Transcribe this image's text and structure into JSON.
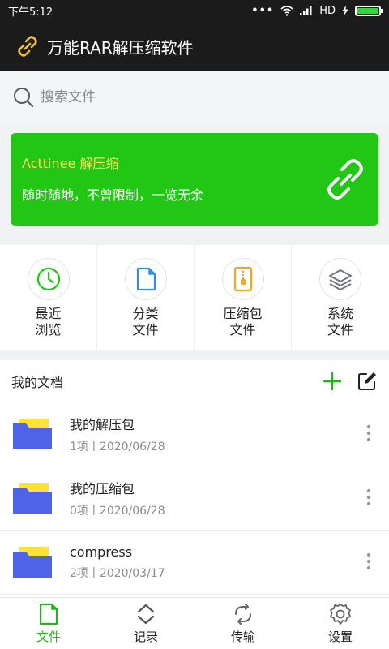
{
  "status": {
    "time": "下午5:12",
    "network": "HD"
  },
  "appbar": {
    "title": "万能RAR解压缩软件"
  },
  "search": {
    "placeholder": "搜索文件"
  },
  "banner": {
    "title": "Acttinee 解压缩",
    "subtitle": "随时随地，不曾限制，一览无余"
  },
  "quick": [
    {
      "line1": "最近",
      "line2": "浏览",
      "icon": "clock-icon"
    },
    {
      "line1": "分类",
      "line2": "文件",
      "icon": "document-icon"
    },
    {
      "line1": "压缩包",
      "line2": "文件",
      "icon": "zip-icon"
    },
    {
      "line1": "系统",
      "line2": "文件",
      "icon": "layers-icon"
    }
  ],
  "docs": {
    "title": "我的文档",
    "items": [
      {
        "name": "我的解压包",
        "meta": "1项丨2020/06/28"
      },
      {
        "name": "我的压缩包",
        "meta": "0项丨2020/06/28"
      },
      {
        "name": "compress",
        "meta": "2项丨2020/03/17"
      }
    ]
  },
  "tabs": [
    {
      "label": "文件",
      "icon": "file-icon"
    },
    {
      "label": "记录",
      "icon": "record-icon"
    },
    {
      "label": "传输",
      "icon": "transfer-icon"
    },
    {
      "label": "设置",
      "icon": "settings-icon"
    }
  ],
  "colors": {
    "accent": "#22c715",
    "bannerTitle": "#ffe95c",
    "dark": "#1b1b1b",
    "folder": "#4f63e8",
    "zip": "#f5a623"
  }
}
